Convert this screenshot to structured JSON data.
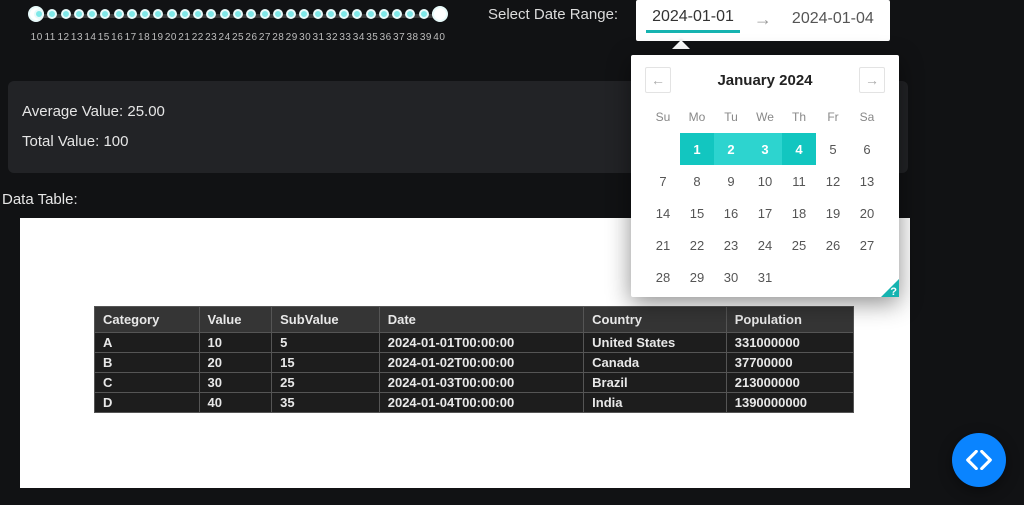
{
  "slider": {
    "ticks": [
      "10",
      "11",
      "12",
      "13",
      "14",
      "15",
      "16",
      "17",
      "18",
      "19",
      "20",
      "21",
      "22",
      "23",
      "24",
      "25",
      "26",
      "27",
      "28",
      "29",
      "30",
      "31",
      "32",
      "33",
      "34",
      "35",
      "36",
      "37",
      "38",
      "39",
      "40"
    ]
  },
  "dateRange": {
    "label": "Select Date Range:",
    "start": "2024-01-01",
    "end": "2024-01-04"
  },
  "calendar": {
    "title": "January 2024",
    "dow": [
      "Su",
      "Mo",
      "Tu",
      "We",
      "Th",
      "Fr",
      "Sa"
    ],
    "days": [
      1,
      2,
      3,
      4,
      5,
      6,
      7,
      8,
      9,
      10,
      11,
      12,
      13,
      14,
      15,
      16,
      17,
      18,
      19,
      20,
      21,
      22,
      23,
      24,
      25,
      26,
      27,
      28,
      29,
      30,
      31
    ],
    "selected_start": 1,
    "selected_end": 4,
    "first_blank_cols": 1
  },
  "stats": {
    "avg_label": "Average Value:",
    "avg_value": "25.00",
    "total_label": "Total Value:",
    "total_value": "100"
  },
  "table": {
    "section_label": "Data Table:",
    "headers": [
      "Category",
      "Value",
      "SubValue",
      "Date",
      "Country",
      "Population"
    ],
    "rows": [
      [
        "A",
        "10",
        "5",
        "2024-01-01T00:00:00",
        "United States",
        "331000000"
      ],
      [
        "B",
        "20",
        "15",
        "2024-01-02T00:00:00",
        "Canada",
        "37700000"
      ],
      [
        "C",
        "30",
        "25",
        "2024-01-03T00:00:00",
        "Brazil",
        "213000000"
      ],
      [
        "D",
        "40",
        "35",
        "2024-01-04T00:00:00",
        "India",
        "1390000000"
      ]
    ]
  }
}
